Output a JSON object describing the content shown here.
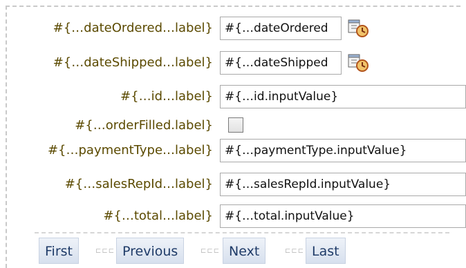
{
  "form": {
    "fields": [
      {
        "label": "#{…dateOrdered…label}",
        "value": "#{…dateOrdered"
      },
      {
        "label": "#{…dateShipped…label}",
        "value": "#{…dateShipped"
      },
      {
        "label": "#{…id…label}",
        "value": "#{…id.inputValue}"
      },
      {
        "label": "#{…orderFilled.label}",
        "checked": false
      },
      {
        "label": "#{…paymentType…label}",
        "value": "#{…paymentType.inputValue}"
      },
      {
        "label": "#{…salesRepId…label}",
        "value": "#{…salesRepId.inputValue}"
      },
      {
        "label": "#{…total…label}",
        "value": "#{…total.inputValue}"
      }
    ],
    "icons": [
      "calendar-clock-icon",
      "calendar-clock-icon"
    ]
  },
  "pager": {
    "first": "First",
    "previous": "Previous",
    "next": "Next",
    "last": "Last",
    "separator": "⊏⊏⊏"
  }
}
